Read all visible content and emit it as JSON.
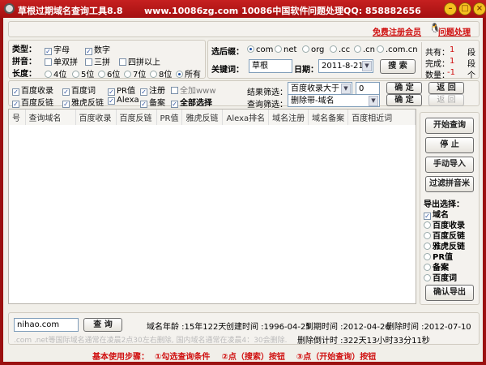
{
  "title": {
    "app": "草根过期域名查询工具8.8",
    "site": "www.10086zg.com  10086中国软件",
    "qq": "问题处理QQ: 858882656"
  },
  "links": {
    "register": "免费注册会员",
    "help": "问题处理"
  },
  "type": {
    "label": "类型：",
    "letters": "字母",
    "digits": "数字"
  },
  "pinyin": {
    "label": "拼音：",
    "opts": [
      "单双拼",
      "三拼",
      "四拼以上"
    ]
  },
  "length": {
    "label": "长度：",
    "opts": [
      "4位",
      "5位",
      "6位",
      "7位",
      "8位",
      "所有"
    ],
    "selected": "所有"
  },
  "suffix": {
    "label": "选后缀：",
    "opts": [
      "com",
      "net",
      "org",
      ".cc",
      ".cn",
      ".com.cn"
    ],
    "selected": "com"
  },
  "keyword": {
    "label": "关键词：",
    "value": "草根"
  },
  "date": {
    "label": "日期：",
    "value": "2011-8-21"
  },
  "search_btn": "搜 索",
  "stats": [
    {
      "label": "共有：",
      "value": "1",
      "unit": "段"
    },
    {
      "label": "完成：",
      "value": "1",
      "unit": "段"
    },
    {
      "label": "数量：",
      "value": "-1",
      "unit": "个"
    }
  ],
  "filters": {
    "row1": [
      "百度收录",
      "百度词",
      "PR值",
      "注册",
      "全加www"
    ],
    "row2": [
      "百度反链",
      "雅虎反链",
      "Alexa",
      "备案",
      "全部选择"
    ]
  },
  "result_filter": {
    "label": "结果筛选：",
    "value": "百度收录大于",
    "num": "0"
  },
  "query_filter": {
    "label": "查询筛选：",
    "value": "删除带-域名"
  },
  "ok": "确 定",
  "back": "返 回",
  "columns": [
    "号",
    "查询域名",
    "百度收录",
    "百度反链",
    "PR值",
    "雅虎反链",
    "Alexa排名",
    "域名注册",
    "域名备案",
    "百度相近词"
  ],
  "side": {
    "start": "开始查询",
    "stop": "停 止",
    "import": "手动导入",
    "filter": "过滤拼音米",
    "export_label": "导出选择：",
    "export_opts": [
      "域名",
      "百度收录",
      "百度反链",
      "雅虎反链",
      "PR值",
      "备案",
      "百度词"
    ],
    "confirm": "确认导出"
  },
  "lookup": {
    "value": "nihao.com",
    "btn": "查 询",
    "age": "域名年龄 :15年122天",
    "created": "创建时间 :1996-04-25",
    "expire": "到期时间 :2012-04-26",
    "delete": "删除时间 :2012-07-10",
    "countdown": "删除倒计时 :322天13小时33分11秒",
    "note": ".com .net等国际域名通常在凌晨2点30左右删除, 国内域名通常在凌晨4：30会删除."
  },
  "steps": "基本使用步骤：  ①勾选查询条件    ②点（搜索）按钮    ③点（开始查询）按钮"
}
